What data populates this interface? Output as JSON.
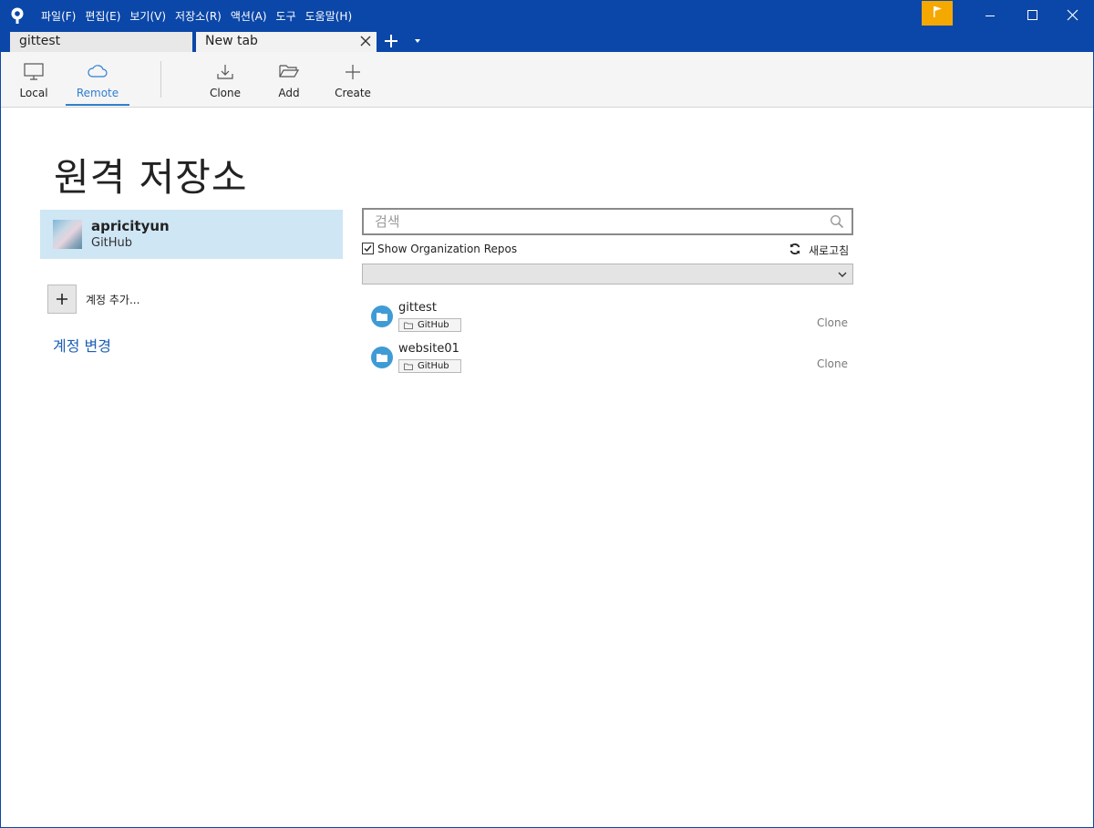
{
  "app": {
    "logo_icon": "sourcetree-logo",
    "accent_color": "#0b47a8",
    "menu": [
      "파일(F)",
      "편집(E)",
      "보기(V)",
      "저장소(R)",
      "액션(A)",
      "도구",
      "도움말(H)"
    ]
  },
  "tabs": [
    {
      "label": "gittest",
      "active": false
    },
    {
      "label": "New tab",
      "active": true
    }
  ],
  "toolbar": {
    "local_label": "Local",
    "remote_label": "Remote",
    "clone_label": "Clone",
    "add_label": "Add",
    "create_label": "Create",
    "active_tab": "Remote"
  },
  "page": {
    "title": "원격 저장소"
  },
  "account": {
    "name": "apricityun",
    "service": "GitHub"
  },
  "sidebar": {
    "add_account_label": "계정 추가...",
    "change_account_label": "계정 변경"
  },
  "search": {
    "placeholder": "검색",
    "value": ""
  },
  "filters": {
    "show_org_repos_label": "Show Organization Repos",
    "show_org_repos_checked": true,
    "refresh_label": "새로고침",
    "select_value": ""
  },
  "repos": [
    {
      "name": "gittest",
      "host": "GitHub",
      "action": "Clone"
    },
    {
      "name": "website01",
      "host": "GitHub",
      "action": "Clone"
    }
  ]
}
